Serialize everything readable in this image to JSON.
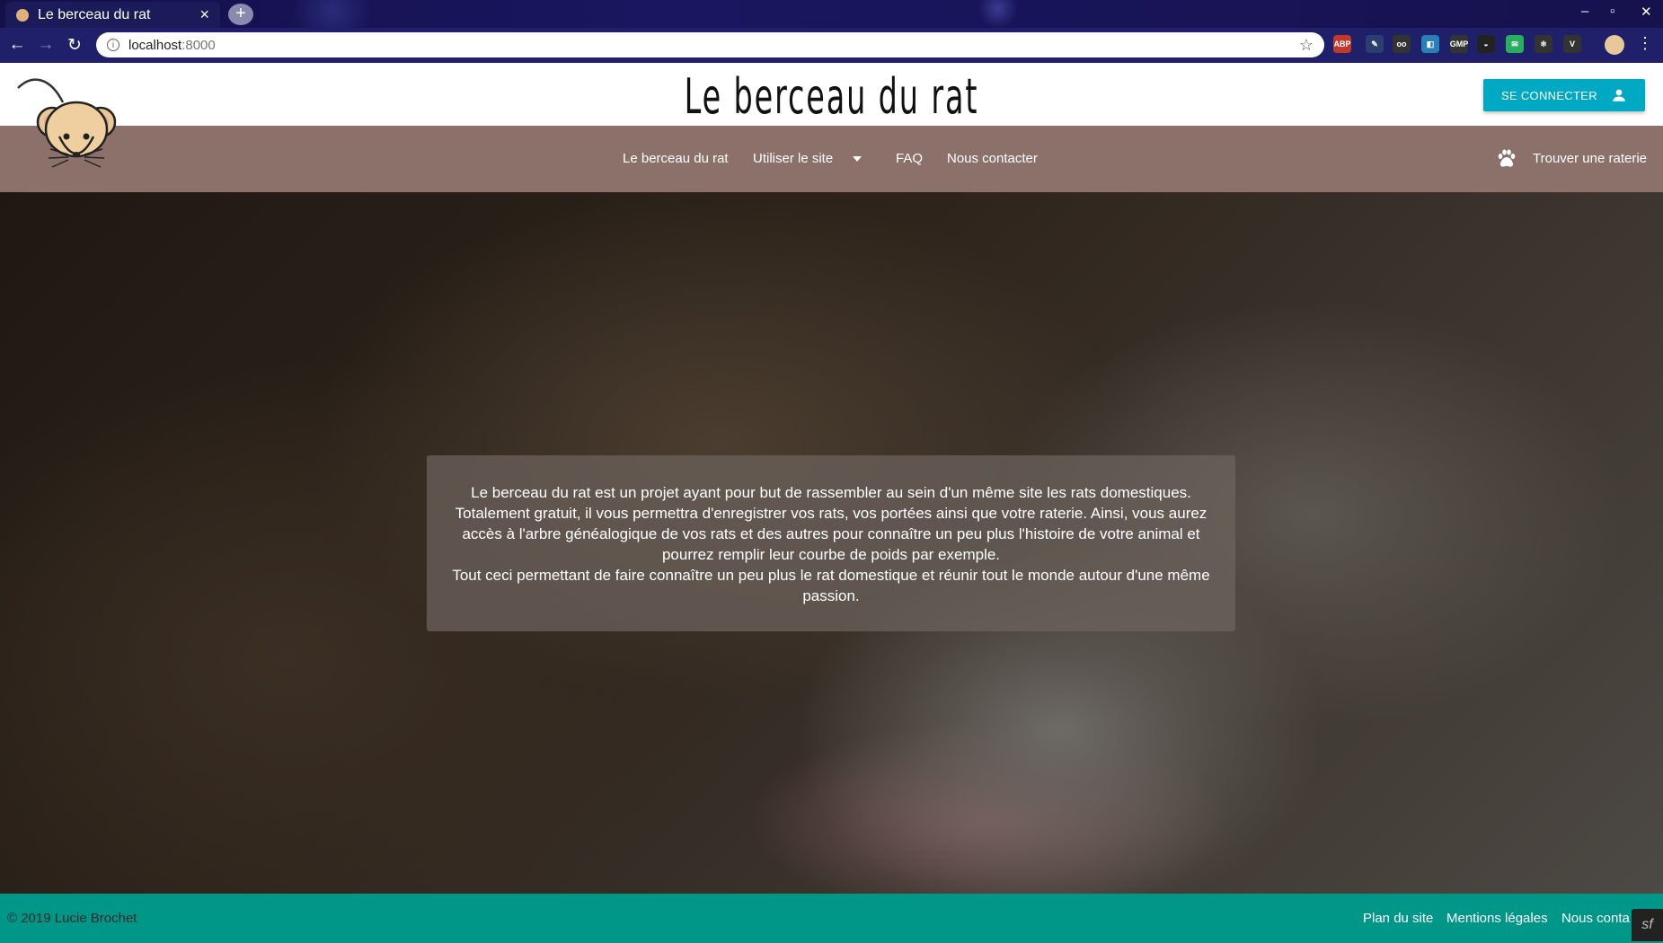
{
  "browser": {
    "tab_title": "Le berceau du rat",
    "tab_close": "×",
    "new_tab": "+",
    "url_host": "localhost",
    "url_port": ":8000",
    "window_controls": [
      "–",
      "▫",
      "✕"
    ],
    "extensions": [
      {
        "name": "abp-extension-icon",
        "text": "ABP",
        "color": "#c0392b"
      },
      {
        "name": "pen-extension-icon",
        "text": "✎",
        "color": "#2c3e70"
      },
      {
        "name": "glasses-extension-icon",
        "text": "oo",
        "color": "#333"
      },
      {
        "name": "square-extension-icon",
        "text": "◧",
        "color": "#2980b9"
      },
      {
        "name": "gmp-extension-icon",
        "text": "GMP",
        "color": "#333"
      },
      {
        "name": "mask-extension-icon",
        "text": "◒",
        "color": "#222"
      },
      {
        "name": "mail-extension-icon",
        "text": "✉",
        "color": "#27ae60"
      },
      {
        "name": "react-extension-icon",
        "text": "⚛",
        "color": "#333"
      },
      {
        "name": "vue-extension-icon",
        "text": "V",
        "color": "#333"
      }
    ]
  },
  "header": {
    "site_title": "Le berceau du rat",
    "login_label": "SE CONNECTER"
  },
  "nav": {
    "items": [
      "Le berceau du rat",
      "Utiliser le site",
      "FAQ",
      "Nous contacter"
    ],
    "find_label": "Trouver une raterie"
  },
  "hero": {
    "paragraph1": "Le berceau du rat est un projet ayant pour but de rassembler au sein d'un même site les rats domestiques. Totalement gratuit, il vous permettra d'enregistrer vos rats, vos portées ainsi que votre raterie. Ainsi, vous aurez accès à l'arbre généalogique de vos rats et des autres pour connaître un peu plus l'histoire de votre animal et pourrez remplir leur courbe de poids par exemple.",
    "paragraph2": "Tout ceci permettant de faire connaître un peu plus le rat domestique et réunir tout le monde autour d'une même passion."
  },
  "footer": {
    "copyright": "© 2019 Lucie Brochet",
    "links": [
      "Plan du site",
      "Mentions légales",
      "Nous conta"
    ],
    "sf_badge": "sf"
  },
  "colors": {
    "nav_bg": "#8c716b",
    "login_bg": "#00a9c3",
    "footer_bg": "#009688"
  }
}
